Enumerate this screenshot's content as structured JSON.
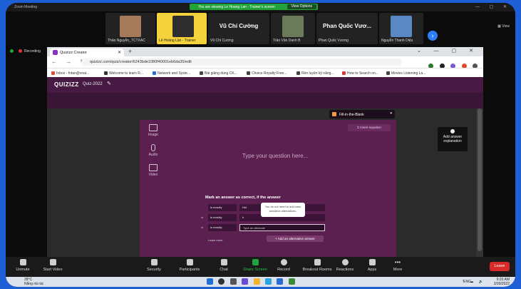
{
  "zoom": {
    "meeting_title": "Zoom Meeting",
    "banner_text": "You are viewing Le Hoang Lan - Trainer's screen",
    "view_options": "View Options",
    "view_label": "View",
    "participants": [
      {
        "name": "Thảo Nguyễn_TCTXAC",
        "big": ""
      },
      {
        "name": "Lê Hoàng Lân - Trainer",
        "big": ""
      },
      {
        "name": "Vũ Chí Cường",
        "big": "Vũ Chí Cường"
      },
      {
        "name": "Trần Văn Danh B",
        "big": ""
      },
      {
        "name": "Phan Quốc Vương",
        "big": "Phan Quốc Vươ..."
      },
      {
        "name": "Nguyễn Thanh Diệu",
        "big": ""
      }
    ],
    "recording_label": "Recording",
    "toolbar": [
      {
        "label": "Unmute",
        "icon": "mic-off-icon"
      },
      {
        "label": "Start Video",
        "icon": "video-off-icon"
      },
      {
        "label": "Security",
        "icon": "shield-icon"
      },
      {
        "label": "Participants",
        "icon": "people-icon",
        "count": "11"
      },
      {
        "label": "Chat",
        "icon": "chat-icon"
      },
      {
        "label": "Share Screen",
        "icon": "share-screen-icon"
      },
      {
        "label": "Record",
        "icon": "record-icon"
      },
      {
        "label": "Breakout Rooms",
        "icon": "breakout-icon"
      },
      {
        "label": "Reactions",
        "icon": "reaction-icon"
      },
      {
        "label": "Apps",
        "icon": "apps-icon"
      },
      {
        "label": "More",
        "icon": "more-icon"
      }
    ],
    "leave_label": "Leave"
  },
  "browser": {
    "tab_title": "Quizizz Creator",
    "url": "quizizz.com/quiz/creator/6243bde1080f40001eb6da35/edit",
    "bookmarks": [
      "Inbox - fntan@vnai...",
      "Welcome to learn R...",
      "Network and Syste...",
      "Bài giảng dùng CK...",
      "Choice Royalty Free...",
      "Rèn luyện kỹ năng...",
      "How to Search on...",
      "Movies Listening La..."
    ]
  },
  "quizizz": {
    "logo": "QUIZIZZ",
    "quiz_name": "Quiz-2022",
    "question_type": "Fill-in-the-Blank",
    "insert_equation": "Σ Insert equation",
    "media": [
      "Image",
      "Audio",
      "Video"
    ],
    "question_placeholder": "Type your question here...",
    "answers_heading": "Mark an answer as correct, if the answer",
    "answer_rows": [
      {
        "prefix": "",
        "condition": "is exactly",
        "value": "Hot"
      },
      {
        "prefix": "or",
        "condition": "is exactly",
        "value": "h"
      },
      {
        "prefix": "or",
        "condition": "is exactly",
        "value": "Type an alternate"
      }
    ],
    "learn_more": "Learn more",
    "add_alt": "+ Add an alternative answer",
    "tooltip": "You do not need to add case sensitive alternatives.",
    "side_panel": "Add answer explanation"
  },
  "taskbar": {
    "temp": "28°C",
    "weather": "Nắng rải rác",
    "lang": "ENG",
    "time": "9:20 AM",
    "date": "3/30/2022"
  }
}
